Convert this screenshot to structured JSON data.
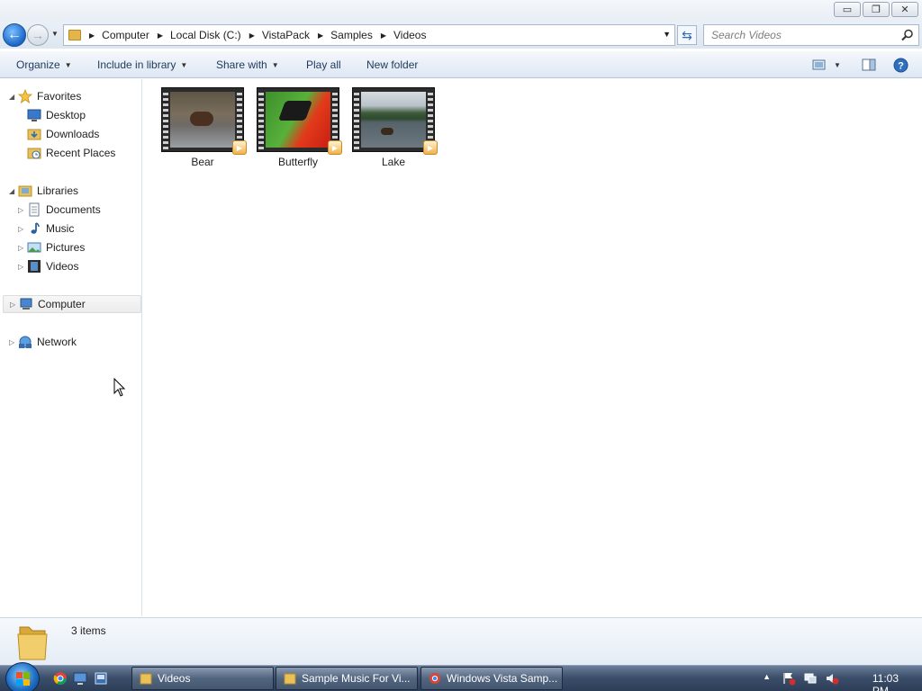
{
  "window": {
    "minimize_glyph": "▭",
    "maximize_glyph": "❐",
    "close_glyph": "✕"
  },
  "address": {
    "breadcrumbs": [
      "Computer",
      "Local Disk (C:)",
      "VistaPack",
      "Samples",
      "Videos"
    ]
  },
  "search": {
    "placeholder": "Search Videos"
  },
  "toolbar": {
    "organize": "Organize",
    "include_in_library": "Include in library",
    "share_with": "Share with",
    "play_all": "Play all",
    "new_folder": "New folder"
  },
  "nav": {
    "favorites": {
      "label": "Favorites",
      "items": [
        "Desktop",
        "Downloads",
        "Recent Places"
      ]
    },
    "libraries": {
      "label": "Libraries",
      "items": [
        "Documents",
        "Music",
        "Pictures",
        "Videos"
      ]
    },
    "computer": "Computer",
    "network": "Network"
  },
  "files": [
    {
      "name": "Bear",
      "icon": "video-thumbnail-bear"
    },
    {
      "name": "Butterfly",
      "icon": "video-thumbnail-butterfly"
    },
    {
      "name": "Lake",
      "icon": "video-thumbnail-lake"
    }
  ],
  "details": {
    "item_count": "3 items"
  },
  "taskbar": {
    "tasks": [
      "Videos",
      "Sample Music For Vi...",
      "Windows Vista Samp..."
    ],
    "clock": "11:03 PM"
  },
  "colors": {
    "accent": "#1e395b",
    "toolbar_bg": "#dde7f3",
    "taskbar_bg": "#3c4f6b"
  }
}
